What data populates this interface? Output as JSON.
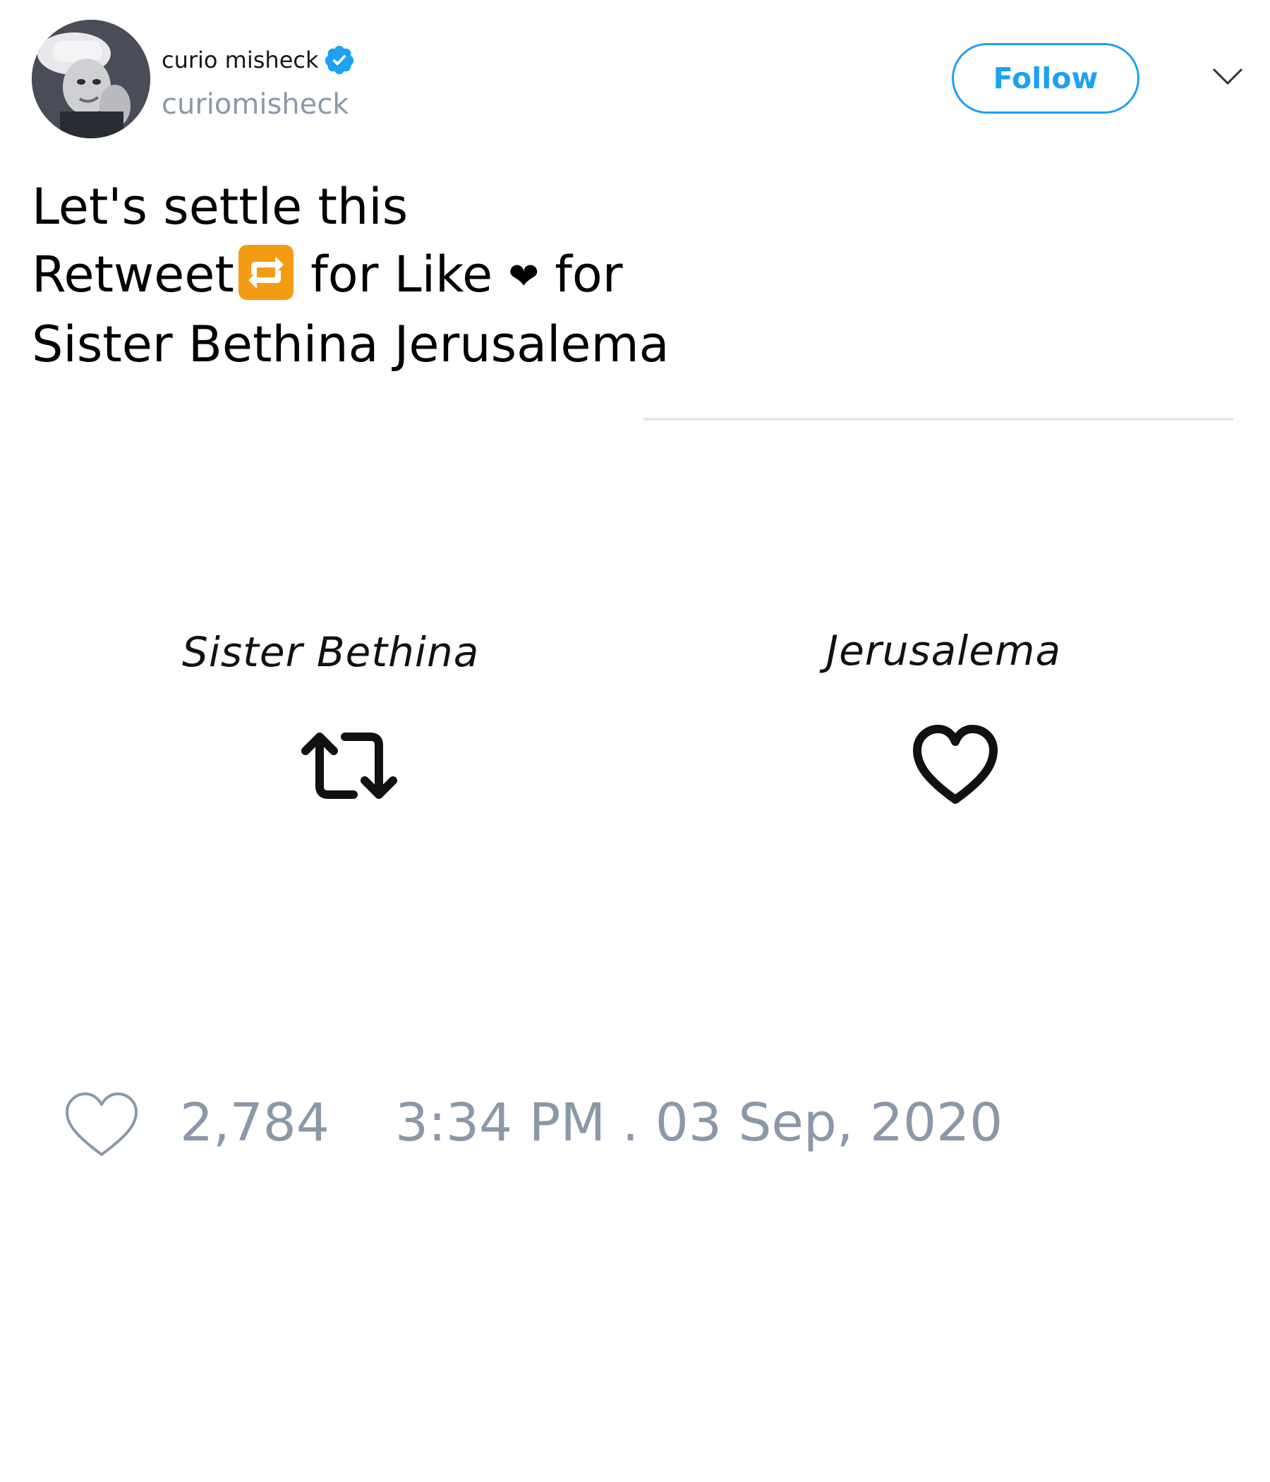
{
  "author": {
    "display_name": "curio misheck",
    "handle": "curiomisheck",
    "verified": true,
    "avatar_icon": "avatar-photo"
  },
  "header": {
    "follow_label": "Follow",
    "menu_icon": "chevron-down-icon"
  },
  "tweet": {
    "lines": [
      "Let's settle this",
      "Retweet",
      " for Like ",
      " for",
      "Sister Bethina Jerusalema"
    ],
    "heart_glyph": "❤"
  },
  "media": {
    "left_label": "Sister Bethina",
    "left_icon": "retweet-icon",
    "right_label": "Jerusalema",
    "right_icon": "heart-icon"
  },
  "footer": {
    "like_count": "2,784",
    "timestamp": "3:34 PM . 03 Sep, 2020"
  },
  "colors": {
    "accent": "#1da1f2",
    "muted_text": "#8b98a9",
    "text": "#000000",
    "retweet_emoji_bg": "#f39c12"
  }
}
